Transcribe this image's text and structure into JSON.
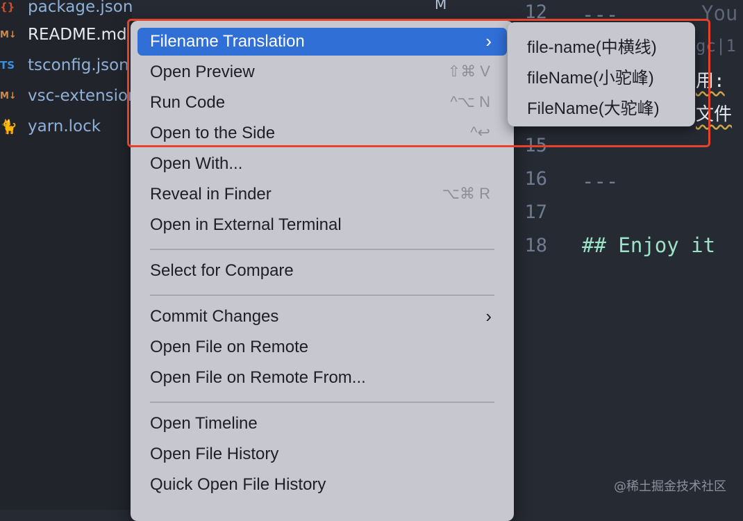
{
  "explorer": {
    "files": [
      {
        "name": "package.json",
        "icon": "json-icon",
        "icon_glyph": "{}",
        "git_status": "M",
        "active": false
      },
      {
        "name": "README.md",
        "icon": "markdown-icon",
        "icon_glyph": "M↓",
        "active": true
      },
      {
        "name": "tsconfig.json",
        "icon": "typescript-config-icon",
        "icon_glyph": "TS",
        "active": false
      },
      {
        "name": "vsc-extension",
        "icon": "markdown-icon",
        "icon_glyph": "M↓",
        "active": false
      },
      {
        "name": "yarn.lock",
        "icon": "yarn-cat-icon",
        "icon_glyph": "🐈",
        "active": false
      }
    ]
  },
  "editor": {
    "line_numbers": [
      "12",
      "15",
      "16",
      "17",
      "18"
    ],
    "code_fragments": {
      "line12": "---",
      "line12_tail": "You",
      "line13_tail": "gc|1",
      "line14_tail": "用:",
      "line14b_tail": "文件",
      "line16": "---",
      "line18": "## Enjoy it"
    }
  },
  "context_menu": {
    "groups": [
      [
        {
          "label": "Filename Translation",
          "submenu": true,
          "selected": true
        },
        {
          "label": "Open Preview",
          "shortcut": "⇧⌘ V"
        },
        {
          "label": "Run Code",
          "shortcut": "^⌥ N"
        },
        {
          "label": "Open to the Side",
          "shortcut": "^↩"
        },
        {
          "label": "Open With..."
        },
        {
          "label": "Reveal in Finder",
          "shortcut": "⌥⌘ R"
        },
        {
          "label": "Open in External Terminal"
        }
      ],
      [
        {
          "label": "Select for Compare"
        }
      ],
      [
        {
          "label": "Commit Changes",
          "submenu": true
        },
        {
          "label": "Open File on Remote"
        },
        {
          "label": "Open File on Remote From..."
        }
      ],
      [
        {
          "label": "Open Timeline"
        },
        {
          "label": "Open File History"
        },
        {
          "label": "Quick Open File History"
        }
      ]
    ]
  },
  "submenu": {
    "items": [
      "file-name(中横线)",
      "fileName(小驼峰)",
      "FileName(大驼峰)"
    ]
  },
  "watermark": "@稀土掘金技术社区",
  "colors": {
    "accent": "#2f6fd6",
    "highlight_border": "#e5422b",
    "menu_bg": "#c7c8cf",
    "editor_bg": "#262a33"
  }
}
